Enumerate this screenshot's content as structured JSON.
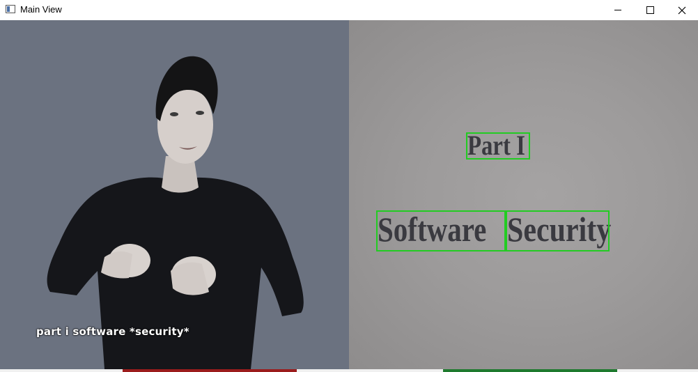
{
  "window": {
    "title": "Main View",
    "controls": {
      "minimize": "minimize",
      "maximize": "maximize",
      "close": "close"
    }
  },
  "left_pane": {
    "caption": "part i software *security*"
  },
  "right_pane": {
    "detected_words": [
      {
        "text": "Part I"
      },
      {
        "text": "Software"
      },
      {
        "text": "Security"
      }
    ],
    "box_color": "#22cc22"
  },
  "bottom_buttons": {
    "left_color": "#9b1c1c",
    "right_color": "#1e7a2e"
  }
}
